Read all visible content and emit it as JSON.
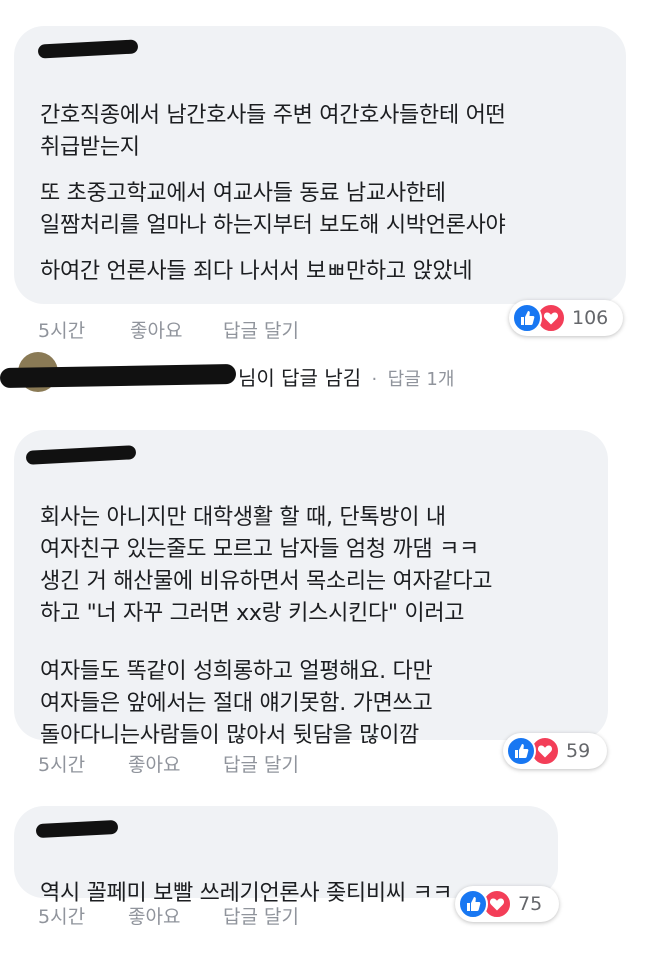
{
  "comments": [
    {
      "lines": [
        "간호직종에서 남간호사들 주변 여간호사들한테 어떤",
        "취급받는지",
        "",
        "또 초중고학교에서 여교사들 동료 남교사한테",
        "일짬처리를 얼마나 하는지부터 보도해 시박언론사야",
        "",
        "하여간 언론사들 죄다 나서서 보ㅃ만하고 앉았네"
      ],
      "time": "5시간",
      "like_label": "좋아요",
      "reply_label": "답글 달기",
      "reaction_count": "106"
    },
    {
      "lines": [
        "회사는 아니지만 대학생활 할 때, 단톡방이 내",
        "여자친구 있는줄도 모르고 남자들 엄청 까댐 ㅋㅋ",
        "생긴 거 해산물에 비유하면서 목소리는 여자같다고",
        "하고 \"너 자꾸 그러면 xx랑 키스시킨다\" 이러고",
        "",
        "여자들도 똑같이 성희롱하고 얼평해요. 다만",
        "여자들은 앞에서는 절대 얘기못함. 가면쓰고",
        "돌아다니는사람들이 많아서 뒷담을 많이깜"
      ],
      "time": "5시간",
      "like_label": "좋아요",
      "reply_label": "답글 달기",
      "reaction_count": "59"
    },
    {
      "lines": [
        "역시 꼴페미 보빨 쓰레기언론사 좆티비씨 ㅋㅋ"
      ],
      "time": "5시간",
      "like_label": "좋아요",
      "reply_label": "답글 달기",
      "reaction_count": "75"
    }
  ],
  "reply_summary": {
    "text": "님이 답글 남김",
    "separator": "·",
    "count_text": "답글 1개"
  },
  "colors": {
    "bubble": "#f0f2f5",
    "like": "#1877f2",
    "love": "#f33e58",
    "meta": "#90949c"
  }
}
